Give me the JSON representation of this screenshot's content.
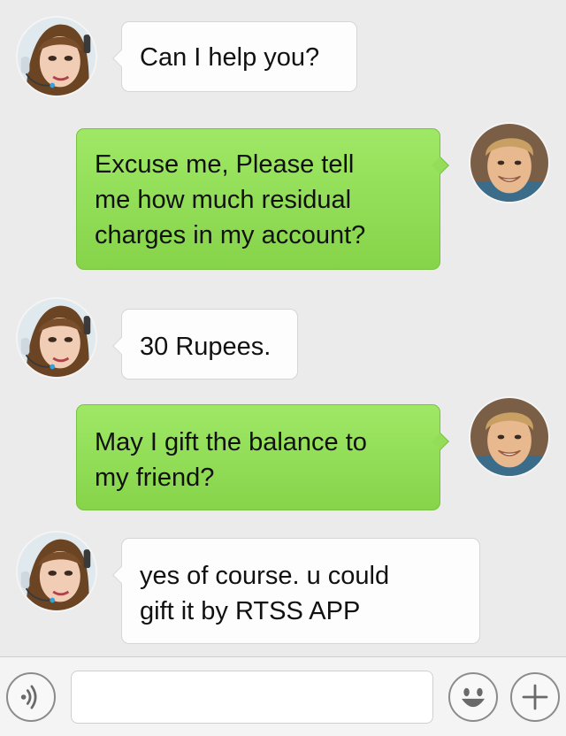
{
  "messages": [
    {
      "from": "agent",
      "text": "Can I help you?"
    },
    {
      "from": "user",
      "text": "Excuse me, Please tell\nme how much residual\ncharges in my account?"
    },
    {
      "from": "agent",
      "text": "30 Rupees."
    },
    {
      "from": "user",
      "text": "May I gift the balance to\nmy friend?"
    },
    {
      "from": "agent",
      "text": "yes of course. u could\ngift it by RTSS APP"
    }
  ],
  "input": {
    "value": "",
    "placeholder": ""
  },
  "icons": {
    "voice": "voice-icon",
    "emoji": "emoji-icon",
    "plus": "plus-icon"
  },
  "colors": {
    "background": "#ebebeb",
    "incoming_bubble": "#fdfdfd",
    "outgoing_bubble": "#8fdc56"
  }
}
